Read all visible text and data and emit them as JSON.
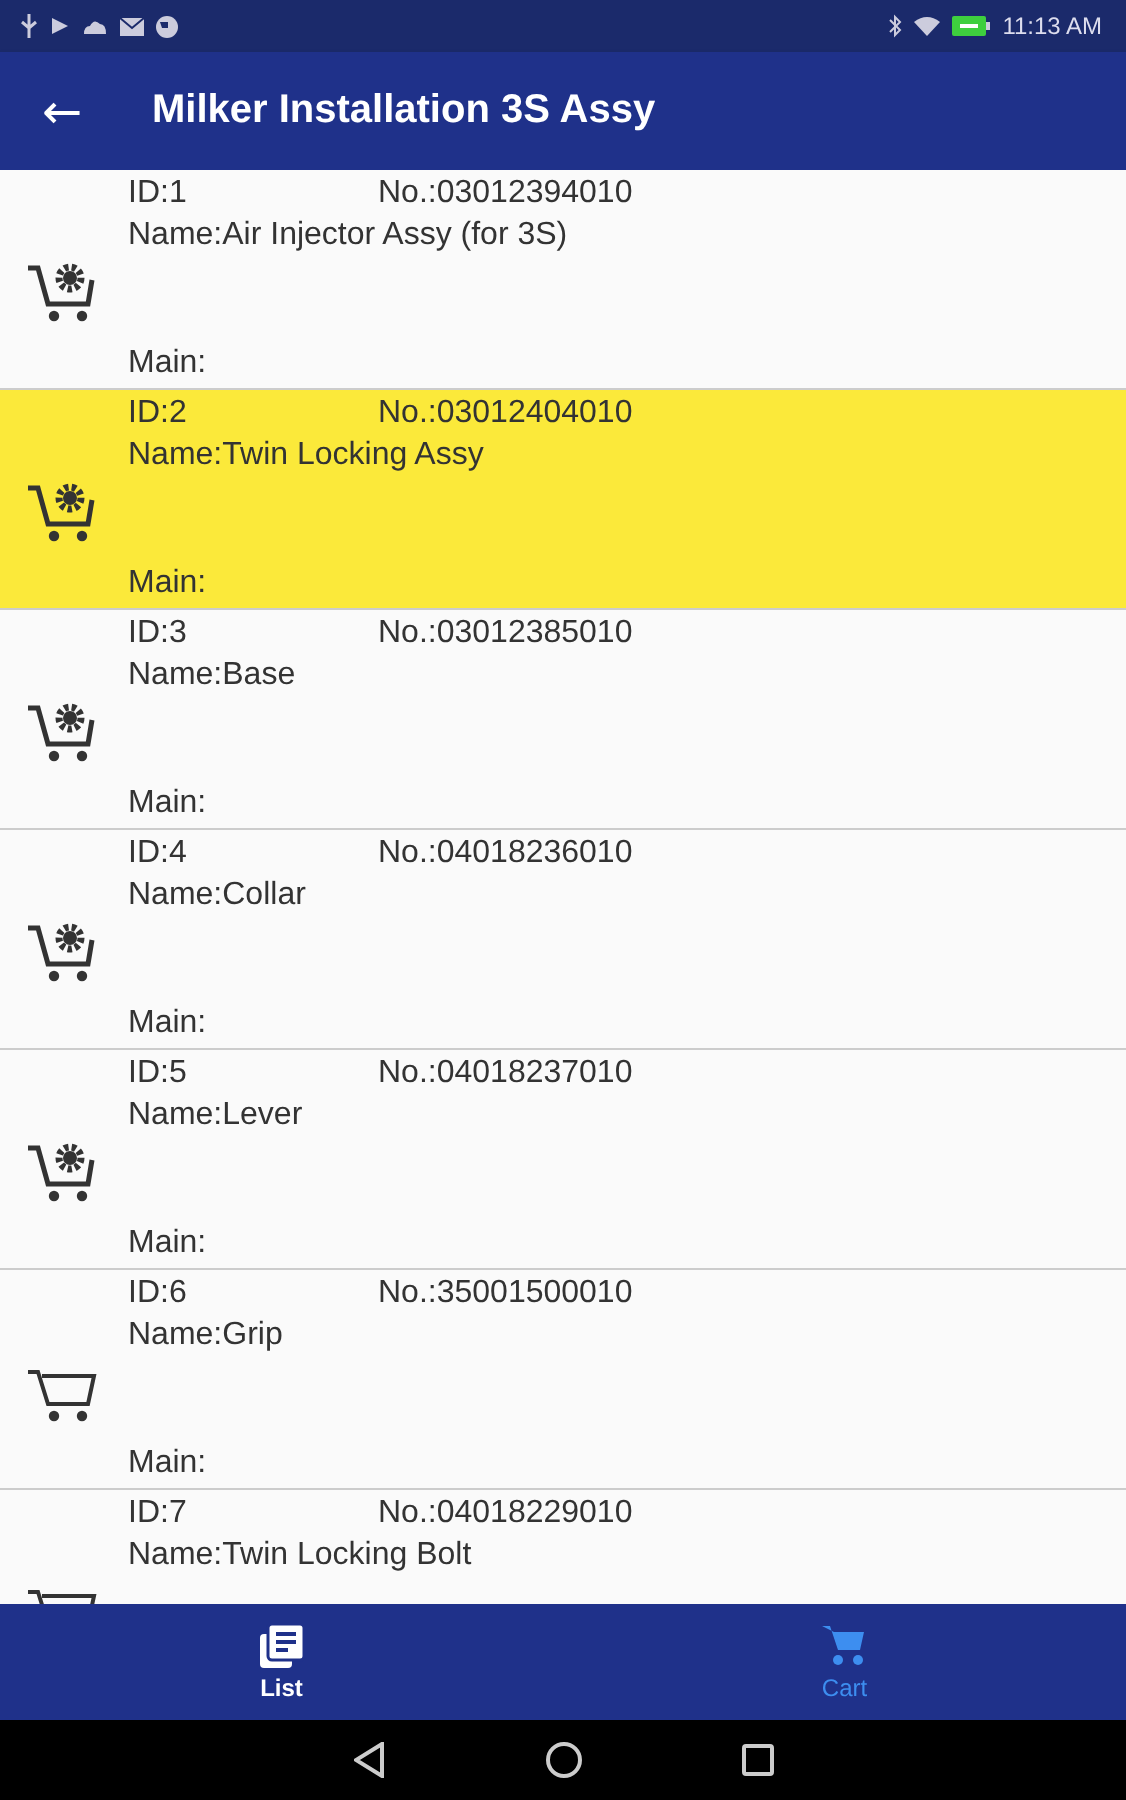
{
  "status_bar": {
    "time": "11:13 AM"
  },
  "app_bar": {
    "back": "←",
    "title": "Milker Installation 3S Assy"
  },
  "items": [
    {
      "kind": "assembly",
      "selected": false,
      "id": "ID:1",
      "no": "No.:03012394010",
      "name": "Name:Air Injector Assy (for 3S)",
      "main": "Main:"
    },
    {
      "kind": "assembly",
      "selected": true,
      "id": "ID:2",
      "no": "No.:03012404010",
      "name": "Name:Twin Locking Assy",
      "main": "Main:"
    },
    {
      "kind": "assembly",
      "selected": false,
      "id": "ID:3",
      "no": "No.:03012385010",
      "name": "Name:Base",
      "main": "Main:"
    },
    {
      "kind": "assembly",
      "selected": false,
      "id": "ID:4",
      "no": "No.:04018236010",
      "name": "Name:Collar",
      "main": "Main:"
    },
    {
      "kind": "assembly",
      "selected": false,
      "id": "ID:5",
      "no": "No.:04018237010",
      "name": "Name:Lever",
      "main": "Main:"
    },
    {
      "kind": "part",
      "selected": false,
      "id": "ID:6",
      "no": "No.:35001500010",
      "name": "Name:Grip",
      "main": "Main:"
    },
    {
      "kind": "part",
      "selected": false,
      "id": "ID:7",
      "no": "No.:04018229010",
      "name": "Name:Twin Locking Bolt"
    }
  ],
  "bottom_nav": [
    {
      "label": "List",
      "kind": "list",
      "selected": true
    },
    {
      "label": "Cart",
      "kind": "cart",
      "selected": false
    }
  ]
}
